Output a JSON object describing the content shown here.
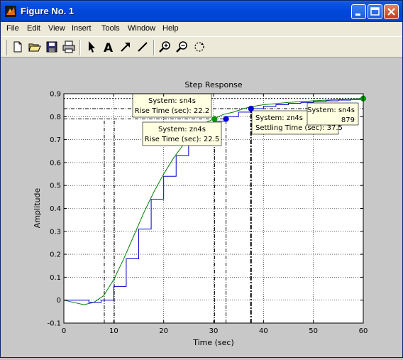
{
  "window": {
    "title": "Figure No. 1"
  },
  "menu": [
    "File",
    "Edit",
    "View",
    "Insert",
    "Tools",
    "Window",
    "Help"
  ],
  "toolbar": [
    "new-file",
    "open-folder",
    "save",
    "print",
    "select-arrow",
    "insert-text",
    "insert-arrow",
    "insert-line",
    "zoom-in",
    "zoom-out",
    "rotate-3d"
  ],
  "chart_data": {
    "type": "line",
    "title": "Step Response",
    "xlabel": "Time (sec)",
    "ylabel": "Amplitude",
    "xlim": [
      0,
      60
    ],
    "ylim": [
      -0.1,
      0.9
    ],
    "xticks": [
      0,
      10,
      20,
      30,
      40,
      50,
      60
    ],
    "yticks": [
      -0.1,
      0,
      0.1,
      0.2,
      0.3,
      0.4,
      0.5,
      0.6,
      0.7,
      0.8,
      0.9
    ],
    "grid": true,
    "series": [
      {
        "name": "sn4s",
        "color": "#008000",
        "kind": "continuous",
        "x": [
          0,
          2,
          4,
          6,
          8,
          10,
          12,
          14,
          16,
          18,
          20,
          22,
          24,
          26,
          28,
          30,
          32,
          34,
          36,
          38,
          40,
          45,
          50,
          55,
          60
        ],
        "y": [
          0,
          -0.01,
          -0.02,
          -0.01,
          0.02,
          0.09,
          0.18,
          0.28,
          0.38,
          0.47,
          0.55,
          0.62,
          0.68,
          0.73,
          0.77,
          0.79,
          0.81,
          0.82,
          0.835,
          0.845,
          0.852,
          0.862,
          0.869,
          0.875,
          0.879
        ]
      },
      {
        "name": "zn4s",
        "color": "#0000cc",
        "kind": "stairs",
        "x": [
          0,
          2.5,
          5,
          7.5,
          10,
          12.5,
          15,
          17.5,
          20,
          22.5,
          25,
          27.5,
          30,
          32.5,
          35,
          37.5,
          40,
          42.5,
          45,
          47.5,
          50,
          52.5,
          55,
          57.5,
          60
        ],
        "y": [
          0,
          0,
          -0.01,
          0,
          0.06,
          0.18,
          0.31,
          0.44,
          0.54,
          0.63,
          0.7,
          0.75,
          0.78,
          0.8,
          0.82,
          0.835,
          0.845,
          0.852,
          0.858,
          0.862,
          0.866,
          0.869,
          0.872,
          0.875,
          0.877
        ]
      }
    ],
    "markers": [
      {
        "series": "sn4s",
        "color": "#009900",
        "x": 30.2,
        "y": 0.79
      },
      {
        "series": "zn4s",
        "color": "#0000dd",
        "x": 32.5,
        "y": 0.79
      },
      {
        "series": "zn4s",
        "color": "#0000dd",
        "x": 37.5,
        "y": 0.835
      },
      {
        "series": "sn4s",
        "color": "#009900",
        "x": 60,
        "y": 0.879
      }
    ],
    "vlines": [
      {
        "x": 8.1,
        "style": "dashdot",
        "ymax": 0.79
      },
      {
        "x": 10.1,
        "style": "dashdot",
        "ymax": 0.79
      },
      {
        "x": 30.2,
        "style": "dashdot",
        "ymax": 0.79
      },
      {
        "x": 32.5,
        "style": "dashdot",
        "ymax": 0.79
      },
      {
        "x": 37.5,
        "style": "dashdot-bold",
        "ymax": 0.835
      }
    ],
    "hlines": [
      {
        "y": 0.79,
        "style": "dashdot",
        "xmax": 32.5
      },
      {
        "y": 0.835,
        "style": "dashdot",
        "xmax": 60
      },
      {
        "y": 0.879,
        "style": "dotted",
        "xmax": 60
      }
    ],
    "annotations": [
      {
        "lines": [
          "System: sn4s",
          "Rise Time (sec): 22.2"
        ]
      },
      {
        "lines": [
          "System: zn4s",
          "Rise Time (sec): 22.5"
        ]
      },
      {
        "lines": [
          "System: zn4s",
          "Settling Time (sec): 37.5"
        ]
      },
      {
        "lines": [
          "System: sn4s",
          "879"
        ]
      }
    ]
  }
}
